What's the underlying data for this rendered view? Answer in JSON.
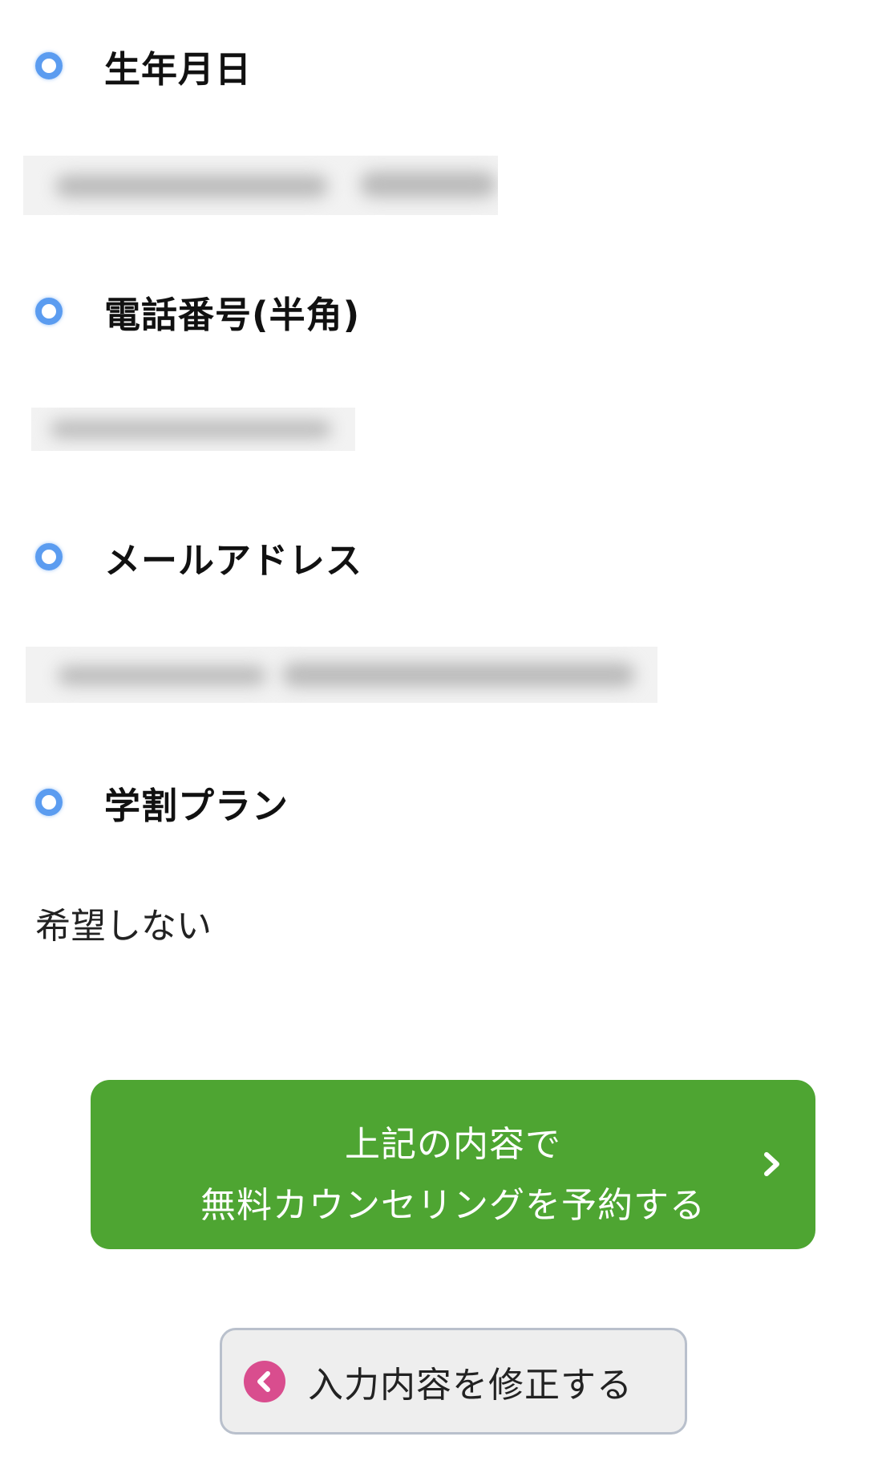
{
  "form": {
    "fields": [
      {
        "label": "生年月日",
        "value_redacted": true
      },
      {
        "label": "電話番号(半角)",
        "value_redacted": true
      },
      {
        "label": "メールアドレス",
        "value_redacted": true
      },
      {
        "label": "学割プラン",
        "value": "希望しない"
      }
    ]
  },
  "icons": {
    "field_marker": "ring-icon",
    "submit_arrow": "chevron-right-icon",
    "back_arrow": "back-circle-icon"
  },
  "actions": {
    "submit_line1": "上記の内容で",
    "submit_line2": "無料カウンセリングを予約する",
    "edit_label": "入力内容を修正する"
  },
  "colors": {
    "accent_ring": "#5b9cf0",
    "submit_bg": "#4ea532",
    "back_icon_bg": "#d94d8e",
    "edit_bg": "#eeeeee"
  }
}
